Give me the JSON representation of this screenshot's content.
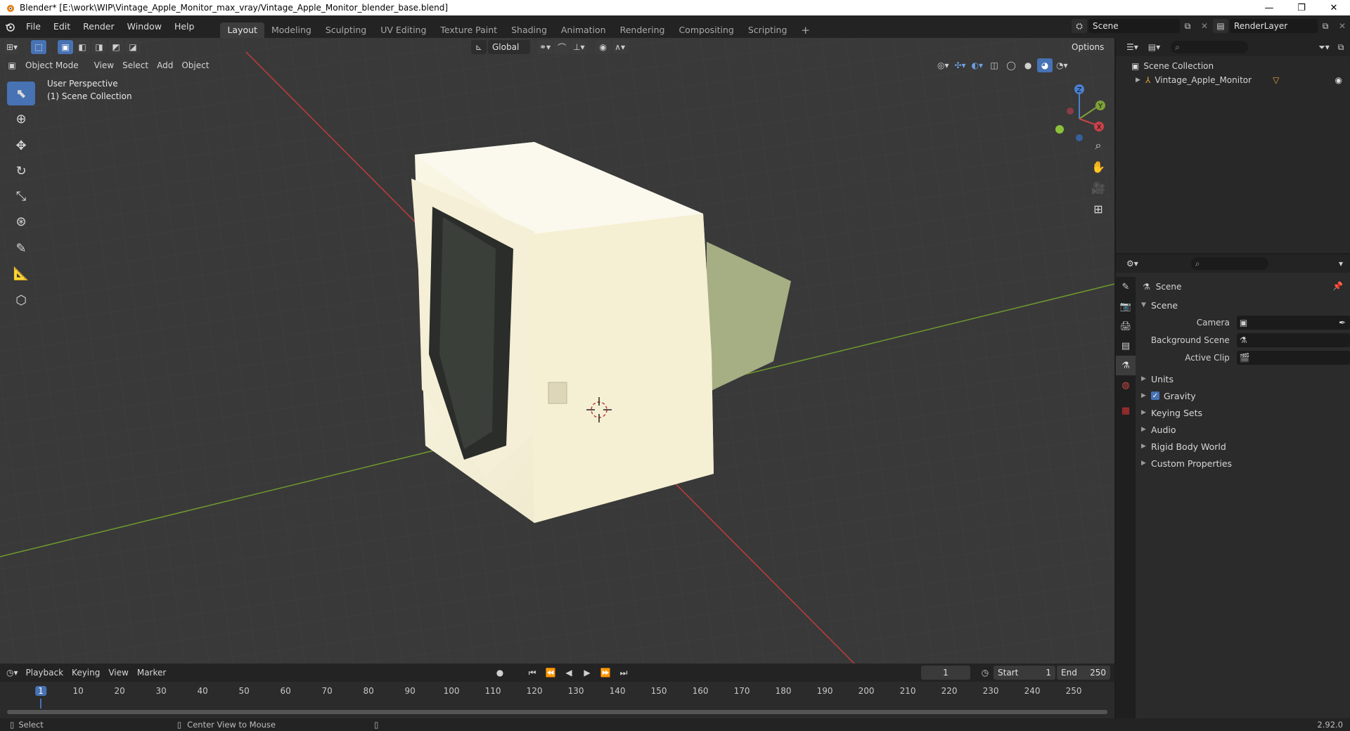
{
  "window": {
    "title": "Blender* [E:\\work\\WIP\\Vintage_Apple_Monitor_max_vray/Vintage_Apple_Monitor_blender_base.blend]",
    "minimize": "—",
    "maximize": "❐",
    "close": "✕"
  },
  "menu": [
    "File",
    "Edit",
    "Render",
    "Window",
    "Help"
  ],
  "workspaces": [
    "Layout",
    "Modeling",
    "Sculpting",
    "UV Editing",
    "Texture Paint",
    "Shading",
    "Animation",
    "Rendering",
    "Compositing",
    "Scripting"
  ],
  "scene": {
    "name": "Scene",
    "render_layer": "RenderLayer"
  },
  "viewport": {
    "mode": "Object Mode",
    "menus": [
      "View",
      "Select",
      "Add",
      "Object"
    ],
    "transform_orientation": "Global",
    "options_label": "Options",
    "overlay_line1": "User Perspective",
    "overlay_line2": "(1) Scene Collection",
    "gizmo": {
      "z": "Z",
      "y": "Y",
      "x": "X"
    }
  },
  "outliner": {
    "root": "Scene Collection",
    "items": [
      {
        "name": "Vintage_Apple_Monitor"
      }
    ]
  },
  "properties": {
    "context_title": "Scene",
    "section": "Scene",
    "camera_label": "Camera",
    "camera_value": "",
    "background_scene_label": "Background Scene",
    "active_clip_label": "Active Clip",
    "panels": [
      "Units",
      "Gravity",
      "Keying Sets",
      "Audio",
      "Rigid Body World",
      "Custom Properties"
    ],
    "gravity_checked": true
  },
  "timeline": {
    "menus": [
      "Playback",
      "Keying",
      "View",
      "Marker"
    ],
    "current_frame": "1",
    "start_label": "Start",
    "start_value": "1",
    "end_label": "End",
    "end_value": "250",
    "ruler": [
      "1",
      "10",
      "20",
      "30",
      "40",
      "50",
      "60",
      "70",
      "80",
      "90",
      "100",
      "110",
      "120",
      "130",
      "140",
      "150",
      "160",
      "170",
      "180",
      "190",
      "200",
      "210",
      "220",
      "230",
      "240",
      "250"
    ]
  },
  "status": {
    "left": "Select",
    "middle": "Center View to Mouse",
    "version": "2.92.0"
  },
  "colors": {
    "accent": "#4772b3",
    "x_axis": "#c23b3b",
    "y_axis": "#6f9a2e",
    "monitor_shell": "#f1ecd3"
  }
}
